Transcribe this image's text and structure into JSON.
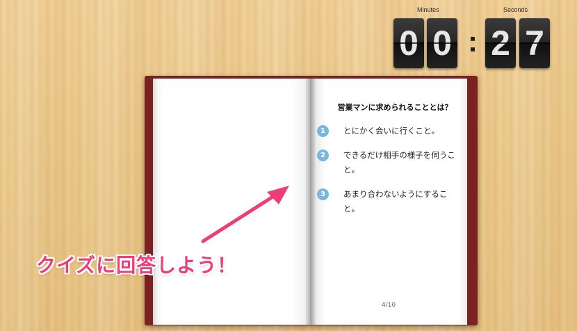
{
  "timer": {
    "minutes_label": "Minutes",
    "seconds_label": "Seconds",
    "digits": [
      "0",
      "0",
      "2",
      "7"
    ],
    "separator": ":"
  },
  "book": {
    "question": "営業マンに求められることとは？",
    "answers": [
      {
        "number": "1",
        "text": "とにかく会いに行くこと。"
      },
      {
        "number": "2",
        "text": "できるだけ相手の様子を伺うこと。"
      },
      {
        "number": "3",
        "text": "あまり合わないようにすること。"
      }
    ],
    "page_indicator": "4/10"
  },
  "annotation": {
    "caption": "クイズに回答しよう！",
    "arrow_icon": "pointer-arrow-icon",
    "accent_color": "#ee3e7a"
  },
  "colors": {
    "book_cover": "#7a2222",
    "answer_badge": "#7ab7de"
  }
}
